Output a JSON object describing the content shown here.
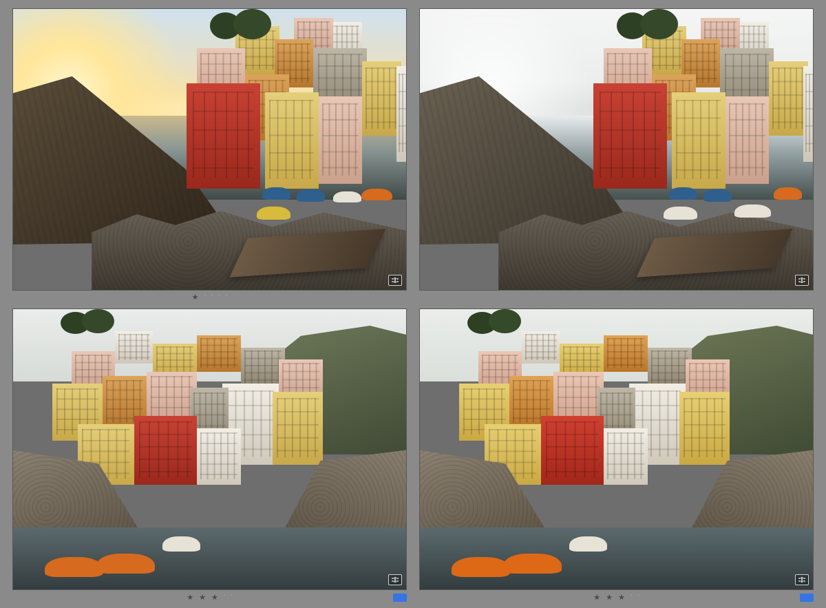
{
  "grid": {
    "cells": [
      {
        "variant": "top",
        "lighting": "sunset",
        "sky_gradient": "linear-gradient(180deg,#cfe1ee 0%,#e7e0c6 35%,#f7e2a8 52%,#ffe9b0 60%)",
        "sun_glow": "radial-gradient(circle at 14% 52%,#fff8d2 0%,#ffe69a 14%,rgba(255,230,154,0) 34%)",
        "cloud_tint": "#f4ecd8",
        "sea_gradient": "linear-gradient(180deg,#c9b98c 0%,#8a9693 40%,#3f4a49 100%)",
        "cliff_color": "linear-gradient(140deg,#5a4d3a 0%,#2e2419 100%)",
        "foam": true,
        "rating": 1,
        "flagged": false,
        "badge": true
      },
      {
        "variant": "top",
        "lighting": "overcast-bright",
        "sky_gradient": "linear-gradient(180deg,#f4f5f4 0%,#eceeee 45%,#dfe3e2 60%)",
        "sun_glow": "radial-gradient(circle at 18% 50%,rgba(255,255,255,0.9) 0%,rgba(255,255,255,0) 30%)",
        "cloud_tint": "#ffffff",
        "sea_gradient": "linear-gradient(180deg,#e8ecec 0%,#9ba8aa 40%,#45514f 100%)",
        "cliff_color": "linear-gradient(140deg,#6a6252 0%,#39322a 100%)",
        "foam": true,
        "rating": 0,
        "flagged": false,
        "badge": true
      },
      {
        "variant": "bottom",
        "lighting": "grey",
        "sky_gradient": "linear-gradient(180deg,#e9ecea 0%,#d7dbd8 100%)",
        "building_sat": "1",
        "rating": 3,
        "flagged": true,
        "flag_color": "#3574e4",
        "badge": true
      },
      {
        "variant": "bottom",
        "lighting": "grey-warm",
        "sky_gradient": "linear-gradient(180deg,#eaedea 0%,#dadfda 100%)",
        "building_sat": "1.08",
        "rating": 3,
        "flagged": true,
        "flag_color": "#3574e4",
        "badge": true
      }
    ],
    "max_stars": 5,
    "star_glyph_filled": "★",
    "star_glyph_empty": "•"
  }
}
